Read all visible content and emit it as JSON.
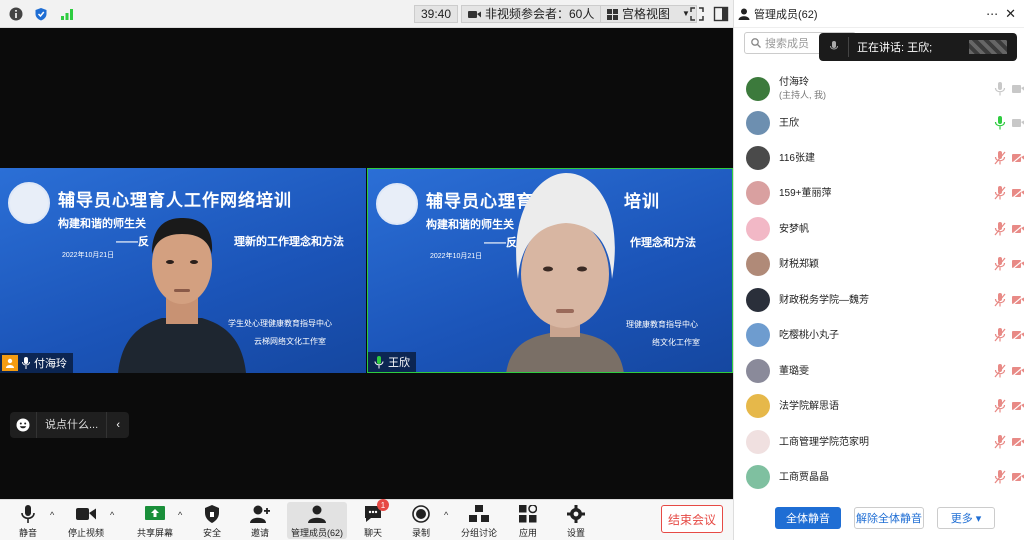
{
  "topbar": {
    "timer": "39:40",
    "non_video_label": "非视频参会者：60人",
    "grid_view_label": "宫格视图"
  },
  "tiles": [
    {
      "name": "付海玲",
      "slide_title": "辅导员心理育人工作网络培训",
      "slide_sub": "构建和谐的师生关",
      "slide_sub_right": "理新的工作理念和方法",
      "slide_sub_prefix": "——反",
      "slide_date": "2022年10月21日",
      "org1": "学生处心理健康教育指导中心",
      "org2": "云梯网络文化工作室"
    },
    {
      "name": "王欣",
      "slide_title_left": "辅导员心理育",
      "slide_title_right": "培训",
      "slide_sub": "构建和谐的师生关",
      "slide_sub_right": "作理念和方法",
      "slide_sub_prefix": "——反",
      "slide_date": "2022年10月21日",
      "org1": "理健康教育指导中心",
      "org2": "络文化工作室"
    }
  ],
  "chat": {
    "placeholder": "说点什么..."
  },
  "toolbar": {
    "mute": "静音",
    "stop_video": "停止视频",
    "share": "共享屏幕",
    "security": "安全",
    "invite": "邀请",
    "manage": "管理成员(62)",
    "chat": "聊天",
    "chat_badge": "1",
    "record": "录制",
    "breakout": "分组讨论",
    "apps": "应用",
    "settings": "设置",
    "end": "结束会议"
  },
  "panel": {
    "title": "管理成员(62)",
    "search_placeholder": "搜索成员",
    "speaking": "正在讲话: 王欣;",
    "members": [
      {
        "name": "付海玲",
        "sub": "(主持人, 我)",
        "mic": "gray",
        "cam": "gray"
      },
      {
        "name": "王欣",
        "sub": "",
        "mic": "green",
        "cam": "gray"
      },
      {
        "name": "116张建",
        "sub": "",
        "mic": "muted",
        "cam": "off"
      },
      {
        "name": "159+董丽萍",
        "sub": "",
        "mic": "muted",
        "cam": "off"
      },
      {
        "name": "安梦帆",
        "sub": "",
        "mic": "muted",
        "cam": "off"
      },
      {
        "name": "财税郑颖",
        "sub": "",
        "mic": "muted",
        "cam": "off"
      },
      {
        "name": "财政税务学院—魏芳",
        "sub": "",
        "mic": "muted",
        "cam": "off"
      },
      {
        "name": "吃樱桃小丸子",
        "sub": "",
        "mic": "muted",
        "cam": "off"
      },
      {
        "name": "董璐雯",
        "sub": "",
        "mic": "muted",
        "cam": "off"
      },
      {
        "name": "法学院解思语",
        "sub": "",
        "mic": "muted",
        "cam": "off"
      },
      {
        "name": "工商管理学院范家明",
        "sub": "",
        "mic": "muted",
        "cam": "off"
      },
      {
        "name": "工商贾晶晶",
        "sub": "",
        "mic": "muted",
        "cam": "off"
      }
    ],
    "mute_all": "全体静音",
    "unmute_all": "解除全体静音",
    "more": "更多 ▾"
  },
  "colors": {
    "accent": "#1f6ed4",
    "end": "#e64a45",
    "speaking_green": "#2ecc40",
    "muted_red": "#e64a45"
  }
}
